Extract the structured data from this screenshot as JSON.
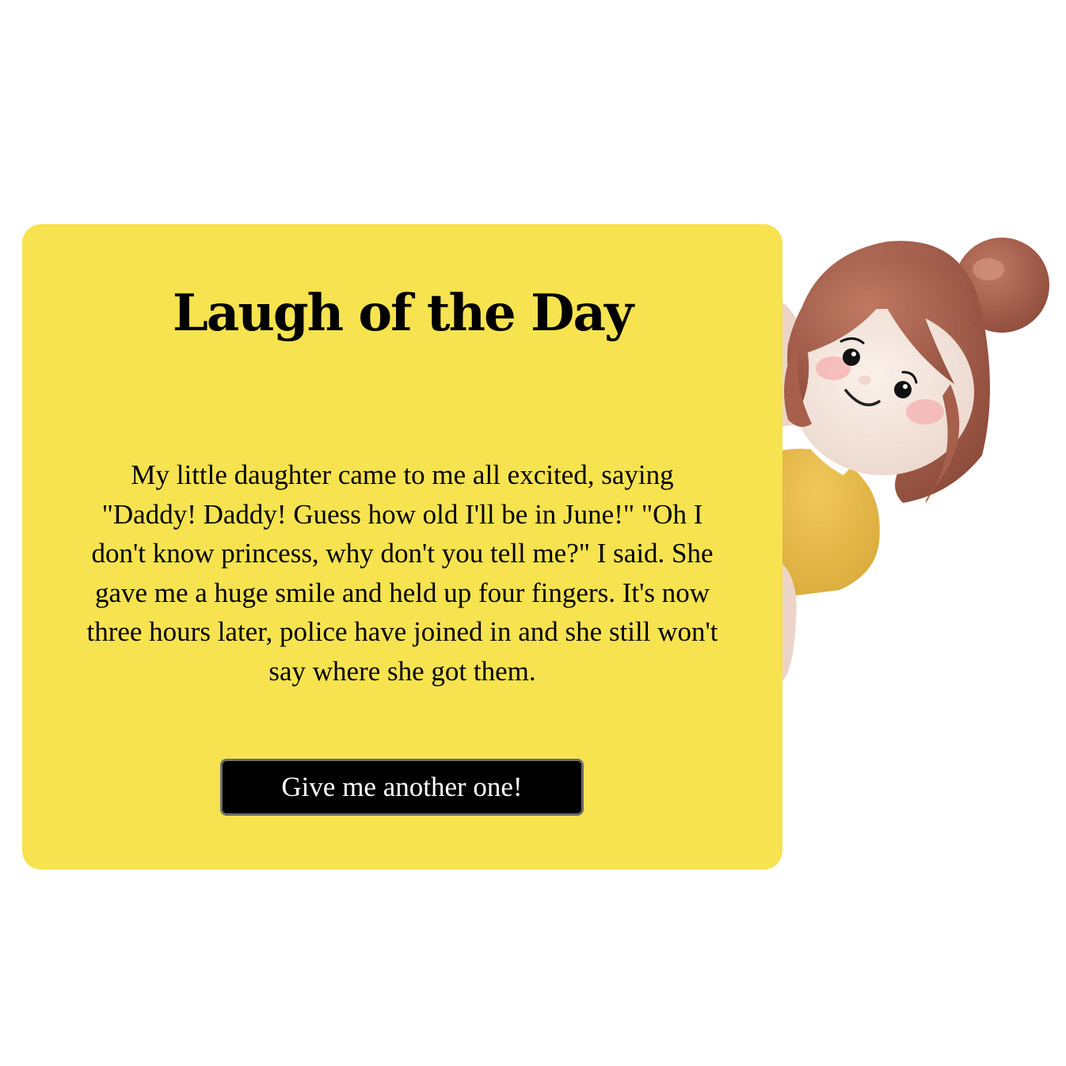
{
  "card": {
    "title": "Laugh of the Day",
    "joke": "My little daughter came to me all excited, saying \"Daddy! Daddy! Guess how old I'll be in June!\" \"Oh I don't know princess, why don't you tell me?\" I said. She gave me a huge smile and held up four fingers. It's now three hours later, police have joined in and she still won't say where she got them.",
    "button_label": "Give me another one!"
  },
  "colors": {
    "card_background": "#f7e34f",
    "button_background": "#000000",
    "button_text": "#ffffff"
  },
  "icons": {
    "illustration": "peeking-girl-illustration"
  }
}
